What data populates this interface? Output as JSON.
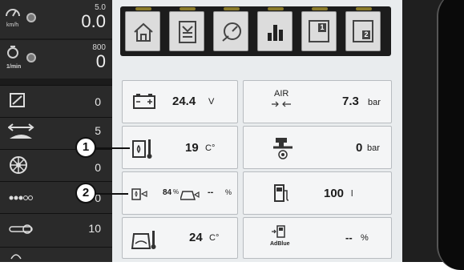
{
  "left_panel": {
    "speed": {
      "small": "5.0",
      "value": "0.0",
      "unit": "km/h"
    },
    "rpm": {
      "small": "800",
      "value": "0",
      "unit": "1/min"
    },
    "rows": [
      {
        "icon": "slope-icon",
        "value": "0"
      },
      {
        "icon": "sprayer-width-icon",
        "value": "5"
      },
      {
        "icon": "wheel-icon",
        "value": "0"
      },
      {
        "icon": "dots-icon",
        "value": "0"
      },
      {
        "icon": "chain-icon",
        "value": "10"
      }
    ]
  },
  "topbar": {
    "buttons": [
      "home-icon",
      "menu-icon",
      "timer-icon",
      "bar-chart-icon",
      "page-1-icon",
      "page-2-icon"
    ],
    "page1": "1",
    "page2": "2"
  },
  "tiles": {
    "battery": {
      "value": "24.4",
      "unit": "V"
    },
    "air": {
      "label": "AIR",
      "value": "7.3",
      "unit": "bar"
    },
    "temp1": {
      "value": "19",
      "unit": "C°"
    },
    "brake": {
      "value": "0",
      "unit": "bar"
    },
    "hydraulic": {
      "percent": "84",
      "percent_unit": "%",
      "value": "--",
      "unit": "%"
    },
    "fuel": {
      "value": "100",
      "unit": "l"
    },
    "oil_temp": {
      "value": "24",
      "unit": "C°"
    },
    "adblue": {
      "label": "AdBlue",
      "value": "--",
      "unit": "%"
    }
  },
  "callouts": [
    "1",
    "2"
  ],
  "colors": {
    "panel_dark": "#1b1b1b",
    "tile_bg": "#f4f5f6",
    "main_bg": "#e9ecee"
  }
}
